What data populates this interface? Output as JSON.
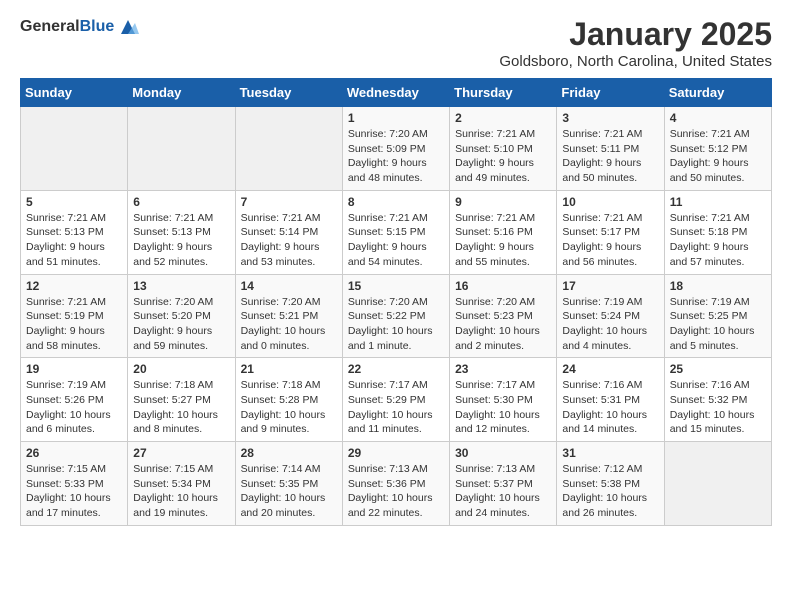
{
  "logo": {
    "general": "General",
    "blue": "Blue"
  },
  "header": {
    "title": "January 2025",
    "subtitle": "Goldsboro, North Carolina, United States"
  },
  "weekdays": [
    "Sunday",
    "Monday",
    "Tuesday",
    "Wednesday",
    "Thursday",
    "Friday",
    "Saturday"
  ],
  "weeks": [
    [
      {
        "day": "",
        "info": ""
      },
      {
        "day": "",
        "info": ""
      },
      {
        "day": "",
        "info": ""
      },
      {
        "day": "1",
        "info": "Sunrise: 7:20 AM\nSunset: 5:09 PM\nDaylight: 9 hours\nand 48 minutes."
      },
      {
        "day": "2",
        "info": "Sunrise: 7:21 AM\nSunset: 5:10 PM\nDaylight: 9 hours\nand 49 minutes."
      },
      {
        "day": "3",
        "info": "Sunrise: 7:21 AM\nSunset: 5:11 PM\nDaylight: 9 hours\nand 50 minutes."
      },
      {
        "day": "4",
        "info": "Sunrise: 7:21 AM\nSunset: 5:12 PM\nDaylight: 9 hours\nand 50 minutes."
      }
    ],
    [
      {
        "day": "5",
        "info": "Sunrise: 7:21 AM\nSunset: 5:13 PM\nDaylight: 9 hours\nand 51 minutes."
      },
      {
        "day": "6",
        "info": "Sunrise: 7:21 AM\nSunset: 5:13 PM\nDaylight: 9 hours\nand 52 minutes."
      },
      {
        "day": "7",
        "info": "Sunrise: 7:21 AM\nSunset: 5:14 PM\nDaylight: 9 hours\nand 53 minutes."
      },
      {
        "day": "8",
        "info": "Sunrise: 7:21 AM\nSunset: 5:15 PM\nDaylight: 9 hours\nand 54 minutes."
      },
      {
        "day": "9",
        "info": "Sunrise: 7:21 AM\nSunset: 5:16 PM\nDaylight: 9 hours\nand 55 minutes."
      },
      {
        "day": "10",
        "info": "Sunrise: 7:21 AM\nSunset: 5:17 PM\nDaylight: 9 hours\nand 56 minutes."
      },
      {
        "day": "11",
        "info": "Sunrise: 7:21 AM\nSunset: 5:18 PM\nDaylight: 9 hours\nand 57 minutes."
      }
    ],
    [
      {
        "day": "12",
        "info": "Sunrise: 7:21 AM\nSunset: 5:19 PM\nDaylight: 9 hours\nand 58 minutes."
      },
      {
        "day": "13",
        "info": "Sunrise: 7:20 AM\nSunset: 5:20 PM\nDaylight: 9 hours\nand 59 minutes."
      },
      {
        "day": "14",
        "info": "Sunrise: 7:20 AM\nSunset: 5:21 PM\nDaylight: 10 hours\nand 0 minutes."
      },
      {
        "day": "15",
        "info": "Sunrise: 7:20 AM\nSunset: 5:22 PM\nDaylight: 10 hours\nand 1 minute."
      },
      {
        "day": "16",
        "info": "Sunrise: 7:20 AM\nSunset: 5:23 PM\nDaylight: 10 hours\nand 2 minutes."
      },
      {
        "day": "17",
        "info": "Sunrise: 7:19 AM\nSunset: 5:24 PM\nDaylight: 10 hours\nand 4 minutes."
      },
      {
        "day": "18",
        "info": "Sunrise: 7:19 AM\nSunset: 5:25 PM\nDaylight: 10 hours\nand 5 minutes."
      }
    ],
    [
      {
        "day": "19",
        "info": "Sunrise: 7:19 AM\nSunset: 5:26 PM\nDaylight: 10 hours\nand 6 minutes."
      },
      {
        "day": "20",
        "info": "Sunrise: 7:18 AM\nSunset: 5:27 PM\nDaylight: 10 hours\nand 8 minutes."
      },
      {
        "day": "21",
        "info": "Sunrise: 7:18 AM\nSunset: 5:28 PM\nDaylight: 10 hours\nand 9 minutes."
      },
      {
        "day": "22",
        "info": "Sunrise: 7:17 AM\nSunset: 5:29 PM\nDaylight: 10 hours\nand 11 minutes."
      },
      {
        "day": "23",
        "info": "Sunrise: 7:17 AM\nSunset: 5:30 PM\nDaylight: 10 hours\nand 12 minutes."
      },
      {
        "day": "24",
        "info": "Sunrise: 7:16 AM\nSunset: 5:31 PM\nDaylight: 10 hours\nand 14 minutes."
      },
      {
        "day": "25",
        "info": "Sunrise: 7:16 AM\nSunset: 5:32 PM\nDaylight: 10 hours\nand 15 minutes."
      }
    ],
    [
      {
        "day": "26",
        "info": "Sunrise: 7:15 AM\nSunset: 5:33 PM\nDaylight: 10 hours\nand 17 minutes."
      },
      {
        "day": "27",
        "info": "Sunrise: 7:15 AM\nSunset: 5:34 PM\nDaylight: 10 hours\nand 19 minutes."
      },
      {
        "day": "28",
        "info": "Sunrise: 7:14 AM\nSunset: 5:35 PM\nDaylight: 10 hours\nand 20 minutes."
      },
      {
        "day": "29",
        "info": "Sunrise: 7:13 AM\nSunset: 5:36 PM\nDaylight: 10 hours\nand 22 minutes."
      },
      {
        "day": "30",
        "info": "Sunrise: 7:13 AM\nSunset: 5:37 PM\nDaylight: 10 hours\nand 24 minutes."
      },
      {
        "day": "31",
        "info": "Sunrise: 7:12 AM\nSunset: 5:38 PM\nDaylight: 10 hours\nand 26 minutes."
      },
      {
        "day": "",
        "info": ""
      }
    ]
  ]
}
